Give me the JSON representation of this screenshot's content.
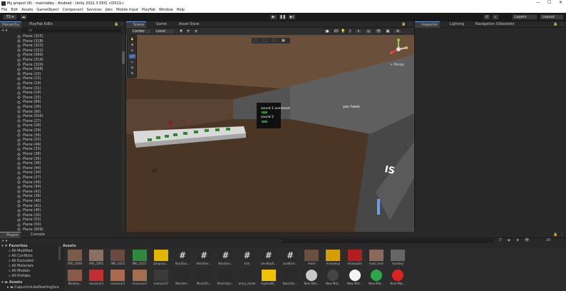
{
  "window": {
    "title": "My project (8) - mainlobby - Android - Unity 2022.3.55f1 <DX11>",
    "controls": [
      "—",
      "☐",
      "✕"
    ]
  },
  "menu": [
    "File",
    "Edit",
    "Assets",
    "GameObject",
    "Component",
    "Services",
    "Jobs",
    "Mobile Input",
    "PlayFab",
    "Window",
    "Help"
  ],
  "toolbar": {
    "account": "TS ▾",
    "layers": "Layers",
    "layout": "Layout"
  },
  "hierarchy": {
    "tabs": [
      "Hierarchy",
      "PlayFab EdEx"
    ],
    "add": "+ ▾",
    "search_placeholder": "All",
    "items": [
      "Plane (325)",
      "Plane (318)",
      "Plane (323)",
      "Plane (322)",
      "Plane (589)",
      "Plane (319)",
      "Plane (320)",
      "Plane (568)",
      "Plane (10)",
      "Plane (13)",
      "Plane (19)",
      "Plane (31)",
      "Plane (14)",
      "Plane (25)",
      "Plane (89)",
      "Plane (26)",
      "Plane (90)",
      "Plane (504)",
      "Plane (27)",
      "Plane (28)",
      "Plane (29)",
      "Plane (30)",
      "Plane (15)",
      "Plane (49)",
      "Plane (33)",
      "Plane (38)",
      "Plane (35)",
      "Plane (36)",
      "Plane (44)",
      "Plane (34)",
      "Plane (37)",
      "Plane (43)",
      "Plane (34)",
      "Plane (42)",
      "Plane (39)",
      "Plane (40)",
      "Plane (41)",
      "Plane (45)",
      "Plane (20)",
      "Plane (53)",
      "Plane (50)",
      "Plane (609)"
    ]
  },
  "scene": {
    "tabs": [
      "Scene",
      "Game",
      "Asset Store"
    ],
    "center": "Center",
    "local": "Local",
    "persp": "< Persp",
    "sign_top": "sound 1 overhead",
    "sign_bottom": "sound 2",
    "wall_text": "you have:",
    "ramp_text": "IS"
  },
  "inspector": {
    "tabs": [
      "Inspector",
      "Lighting",
      "Navigation (Obsolete)"
    ]
  },
  "bottom": {
    "tabs": [
      "Project",
      "Console"
    ],
    "add": "+ ▾",
    "count": "20",
    "favorites_label": "Favorites",
    "favorites": [
      "All Modified",
      "All Conflicts",
      "All Excluded",
      "All Materials",
      "All Models",
      "All Prefabs"
    ],
    "assets_label": "Assets",
    "assets_folder": "CapuchinLikeStartingSce",
    "breadcrumb": "Assets",
    "row1": [
      "IMG_5608",
      "IMG_5695",
      "IMG_6255",
      "IMG_6257",
      "Jumpsca...",
      "KeraDus...",
      "KeraSen...",
      "KeraSen...",
      "kick",
      "LevelUpS...",
      "LoadSce...",
      "mesh",
      "mineskuy",
      "minespike",
      "mod_vent",
      "monkey"
    ],
    "row2": [
      "Monkey...",
      "monocar1",
      "monocar2",
      "monocar3",
      "monocar7",
      "Monster...",
      "MusicOn...",
      "MusicSpa...",
      "army_mode",
      "mybeat8...",
      "NameSn...",
      "New Mat...",
      "New Mat...",
      "New Mat...",
      "New Mat...",
      "New Mat..."
    ]
  },
  "colors": {
    "accent": "#6aa0e6",
    "panel": "#282828",
    "bg": "#191919",
    "floor": "#4a3524",
    "wall": "#5f5f5f"
  }
}
